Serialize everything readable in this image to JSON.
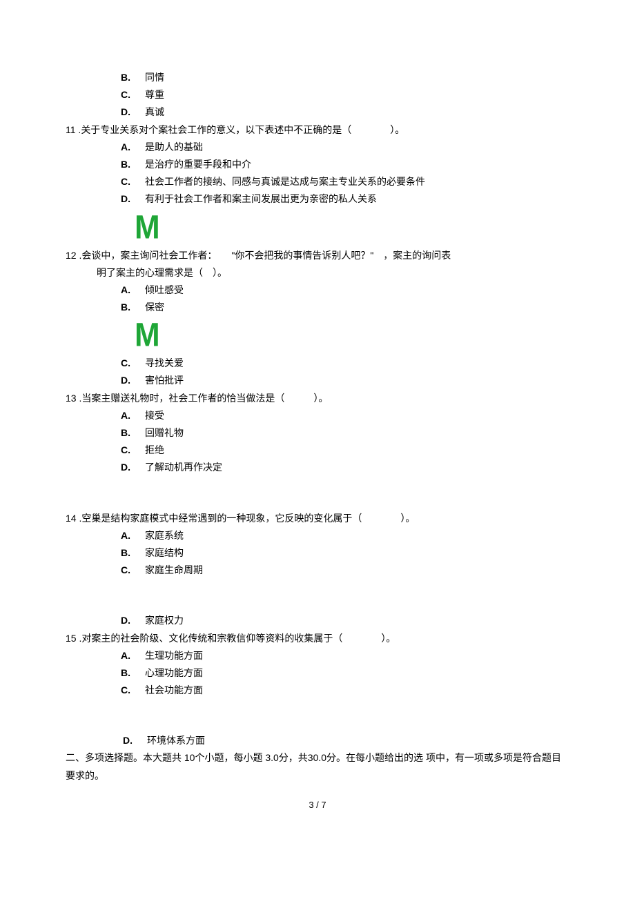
{
  "options_intro": [
    {
      "l": "B.",
      "t": "同情"
    },
    {
      "l": "C.",
      "t": "尊重"
    },
    {
      "l": "D.",
      "t": "真诚"
    }
  ],
  "q11": {
    "num": "11 .",
    "text": "关于专业关系对个案社会工作的意义，以下表述中不正确的是（　　　　）。",
    "opts": [
      {
        "l": "A.",
        "t": "是助人的基础"
      },
      {
        "l": "B.",
        "t": "是治疗的重要手段和中介"
      },
      {
        "l": "C.",
        "t": "社会工作者的接纳、同感与真诚是达成与案主专业关系的必要条件"
      },
      {
        "l": "D.",
        "t": "有利于社会工作者和案主间发展出更为亲密的私人关系"
      }
    ]
  },
  "watermark": "M",
  "q12": {
    "num": "12 .",
    "text_a": "会谈中，案主询问社会工作者：　　\"你不会把我的事情告诉别人吧？\"　，案主的询问表",
    "text_b": "明了案主的心理需求是（　）。",
    "opts_a": [
      {
        "l": "A.",
        "t": "倾吐感受"
      },
      {
        "l": "B.",
        "t": "保密"
      }
    ],
    "opts_b": [
      {
        "l": "C.",
        "t": "寻找关爱"
      },
      {
        "l": "D.",
        "t": "害怕批评"
      }
    ]
  },
  "q13": {
    "num": "13 .",
    "text": "当案主赠送礼物时，社会工作者的恰当做法是（　　　）。",
    "opts": [
      {
        "l": "A.",
        "t": "接受"
      },
      {
        "l": "B.",
        "t": "回赠礼物"
      },
      {
        "l": "C.",
        "t": "拒绝"
      },
      {
        "l": "D.",
        "t": "了解动机再作决定"
      }
    ]
  },
  "q14": {
    "num": "14 .",
    "text": "空巢是结构家庭模式中经常遇到的一种现象，它反映的变化属于（　　　　）。",
    "opts_a": [
      {
        "l": "A.",
        "t": "家庭系统"
      },
      {
        "l": "B.",
        "t": "家庭结构"
      },
      {
        "l": "C.",
        "t": "家庭生命周期"
      }
    ],
    "opts_b": [
      {
        "l": "D.",
        "t": "家庭权力"
      }
    ]
  },
  "q15": {
    "num": "15 .",
    "text": "对案主的社会阶级、文化传统和宗教信仰等资料的收集属于（　　　　）。",
    "opts_a": [
      {
        "l": "A.",
        "t": "生理功能方面"
      },
      {
        "l": "B.",
        "t": "心理功能方面"
      },
      {
        "l": "C.",
        "t": "社会功能方面"
      }
    ],
    "opts_b": [
      {
        "l": "D.",
        "t": "环境体系方面"
      }
    ]
  },
  "section2": "二、多项选择题。本大题共 10个小题，每小题 3.0分，共30.0分。在每小题给出的选 项中，有一项或多项是符合题目要求的。",
  "footer": "3 / 7"
}
